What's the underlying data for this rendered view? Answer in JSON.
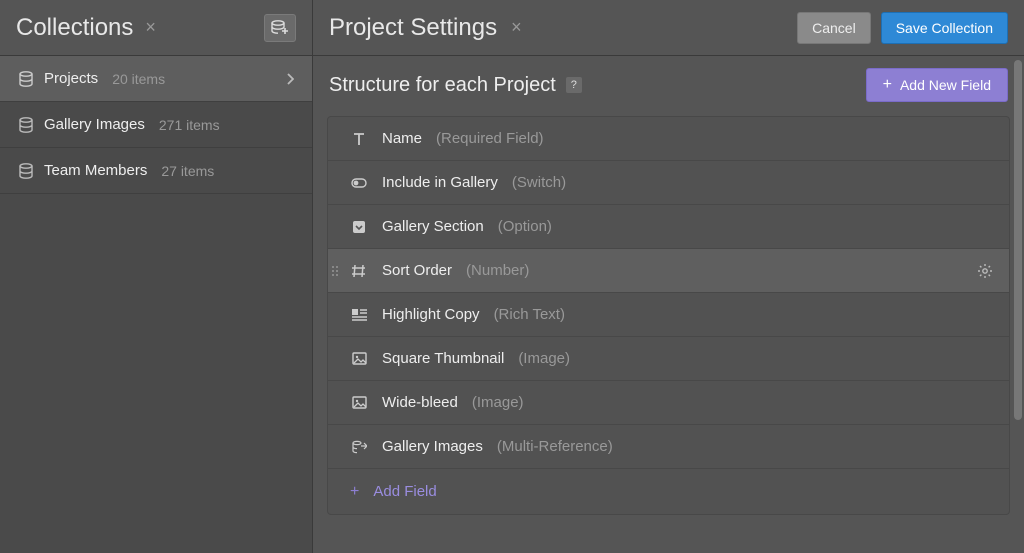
{
  "sidebar": {
    "title": "Collections",
    "items": [
      {
        "label": "Projects",
        "count": "20 items",
        "active": true
      },
      {
        "label": "Gallery Images",
        "count": "271 items",
        "active": false
      },
      {
        "label": "Team Members",
        "count": "27 items",
        "active": false
      }
    ]
  },
  "header": {
    "title": "Project Settings",
    "cancel": "Cancel",
    "save": "Save Collection"
  },
  "structure": {
    "title": "Structure for each Project",
    "help": "?",
    "add_new_field": "Add New Field",
    "add_field": "Add Field"
  },
  "fields": [
    {
      "icon": "text",
      "name": "Name",
      "type": "(Required Field)",
      "highlight": false
    },
    {
      "icon": "switch",
      "name": "Include in Gallery",
      "type": "(Switch)",
      "highlight": false
    },
    {
      "icon": "option",
      "name": "Gallery Section",
      "type": "(Option)",
      "highlight": false
    },
    {
      "icon": "number",
      "name": "Sort Order",
      "type": "(Number)",
      "highlight": true,
      "gear": true
    },
    {
      "icon": "richtext",
      "name": "Highlight Copy",
      "type": "(Rich Text)",
      "highlight": false
    },
    {
      "icon": "image",
      "name": "Square Thumbnail",
      "type": "(Image)",
      "highlight": false
    },
    {
      "icon": "image",
      "name": "Wide-bleed",
      "type": "(Image)",
      "highlight": false
    },
    {
      "icon": "multiref",
      "name": "Gallery Images",
      "type": "(Multi-Reference)",
      "highlight": false
    }
  ],
  "colors": {
    "accent": "#8d7fd3",
    "primary": "#2e89d6"
  }
}
